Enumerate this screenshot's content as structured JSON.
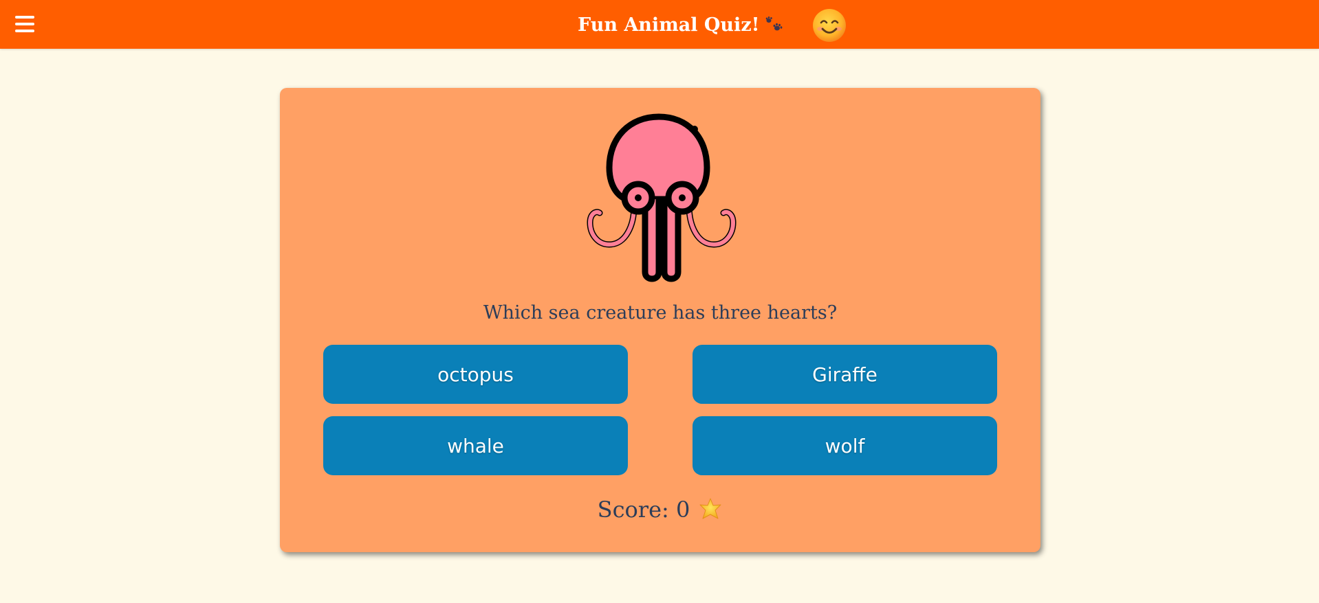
{
  "header": {
    "title": "Fun Animal Quiz!",
    "menu_icon": "hamburger-menu-icon",
    "title_icon": "paw-prints-icon",
    "avatar_icon": "smiling-face-icon"
  },
  "quiz": {
    "image_icon": "octopus-icon",
    "question": "Which sea creature has three hearts?",
    "answers": [
      {
        "label": "octopus"
      },
      {
        "label": "Giraffe"
      },
      {
        "label": "whale"
      },
      {
        "label": "wolf"
      }
    ],
    "score_label": "Score: 0",
    "score_value": 0,
    "score_icon": "star-icon"
  },
  "colors": {
    "header_bg": "#ff5e00",
    "page_bg": "#fef9e7",
    "card_bg": "#ffa064",
    "button_bg": "#0a80b8",
    "text_dark": "#2b3d59",
    "octopus_pink": "#ff7f96"
  }
}
